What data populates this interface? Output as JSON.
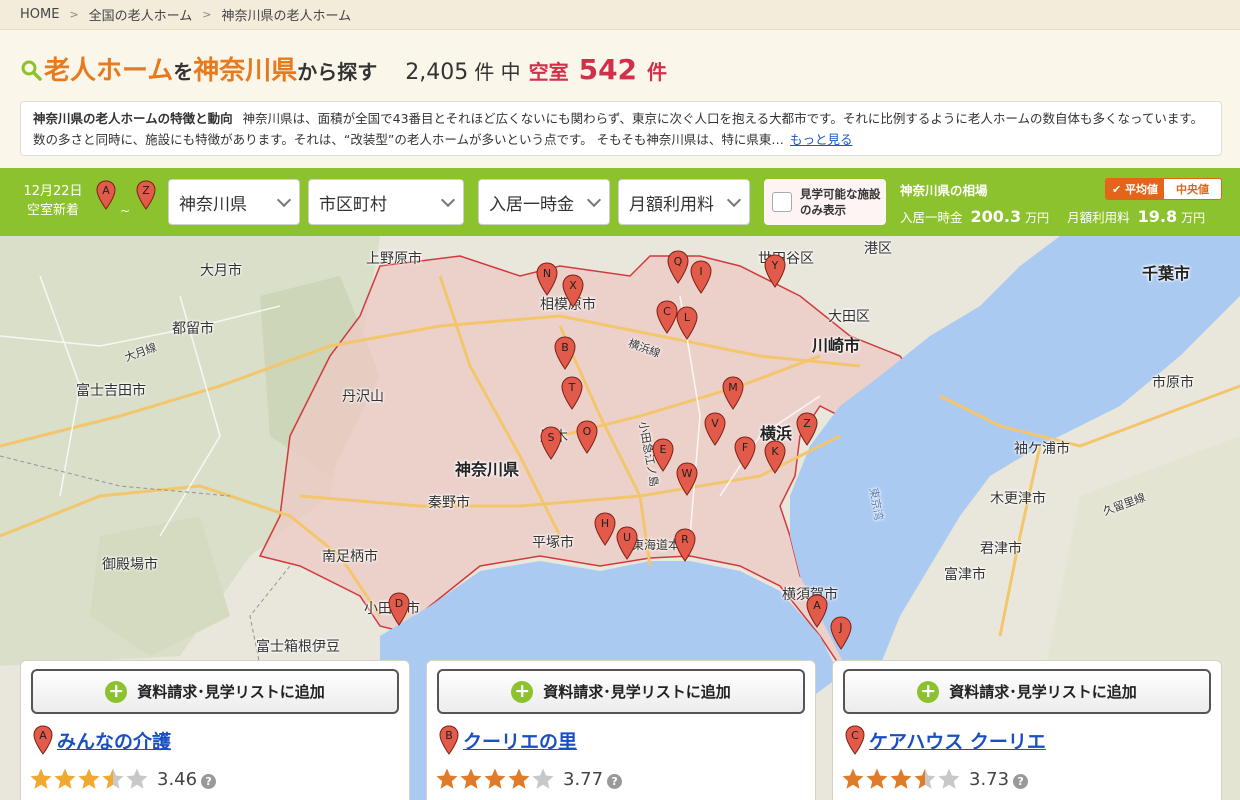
{
  "breadcrumb": [
    "HOME",
    "全国の老人ホーム",
    "神奈川県の老人ホーム"
  ],
  "heading": {
    "part1": "老人ホーム",
    "part2": "を",
    "part3": "神奈川県",
    "part4": "から探す",
    "total": "2,405",
    "total_unit": "件 中",
    "vacancy_label": "空室",
    "vacancy_count": "542",
    "vacancy_unit": "件"
  },
  "description": {
    "heading": "神奈川県の老人ホームの特徴と動向",
    "body": "神奈川県は、面積が全国で43番目とそれほど広くないにも関わらず、東京に次ぐ人口を抱える大都市です。それに比例するように老人ホームの数自体も多くなっています。数の多さと同時に、施設にも特徴があります。それは、“改装型”の老人ホームが多いという点です。 そもそも神奈川県は、特に県東…",
    "more": "もっと見る"
  },
  "filters": {
    "new_label_date": "12月22日",
    "new_label_text": "空室新着",
    "pin_from": "A",
    "pin_to": "Z",
    "tilde": "~",
    "prefecture": "神奈川県",
    "city": "市区町村",
    "entry_fee": "入居一時金",
    "monthly_fee": "月額利用料",
    "visit_only": "見学可能な施設のみ表示"
  },
  "market": {
    "title": "神奈川県の相場",
    "entry_label": "入居一時金",
    "entry_value": "200.3",
    "monthly_label": "月額利用料",
    "monthly_value": "19.8",
    "unit": "万円",
    "toggle_average": "平均値",
    "toggle_median": "中央値"
  },
  "map": {
    "labels": {
      "sagamihara": "相模原市",
      "kanagawa": "神奈川県",
      "kawasaki": "川崎市",
      "yokohama": "横浜",
      "tanzawa": "丹沢山",
      "hadano": "秦野市",
      "hiratsuka": "平塚市",
      "minamiashigara": "南足柄市",
      "odawara": "小田原市",
      "yokosuka": "横須賀市",
      "chiba": "千葉市",
      "ichihara": "市原市",
      "sodegaura": "袖ケ浦市",
      "kisarazu": "木更津市",
      "kimitsu": "君津市",
      "futtsu": "富津市",
      "setagaya": "世田谷区",
      "ota": "大田区",
      "minato": "港区",
      "otsuki": "大月市",
      "tsuru": "都留市",
      "fujiyoshida": "富士吉田市",
      "gotemba": "御殿場市",
      "uenohara": "上野原市",
      "hakone": "富士箱根伊豆",
      "atsugi": "厚木",
      "tokaido": "東海道本",
      "yokohama_line": "横浜線",
      "otsuki_line": "大月線",
      "odakyu": "小田急江ノ島",
      "kuruma": "久留里線",
      "tokyo_bay": "東京湾"
    },
    "markers": [
      "N",
      "X",
      "Q",
      "I",
      "Y",
      "C",
      "L",
      "B",
      "T",
      "M",
      "S",
      "O",
      "E",
      "V",
      "Z",
      "F",
      "K",
      "W",
      "H",
      "U",
      "R",
      "D",
      "A",
      "J"
    ]
  },
  "cards": [
    {
      "add_label": "資料請求･見学リストに追加",
      "pin": "A",
      "name": "みんなの介護",
      "rating": "3.46",
      "stars": 3.46
    },
    {
      "add_label": "資料請求･見学リストに追加",
      "pin": "B",
      "name": "クーリエの里",
      "rating": "3.77",
      "stars": 3.77
    },
    {
      "add_label": "資料請求･見学リストに追加",
      "pin": "C",
      "name": "ケアハウス クーリエ",
      "rating": "3.73",
      "stars": 3.73
    }
  ],
  "colors": {
    "accent_green": "#8cc22d",
    "title_orange": "#e87a1e",
    "vacancy_red": "#d0304a",
    "link_blue": "#1a4fc2",
    "marker_red": "#e15a4a",
    "star_gold": "#f0a92e",
    "star_orange": "#e07b2a"
  }
}
